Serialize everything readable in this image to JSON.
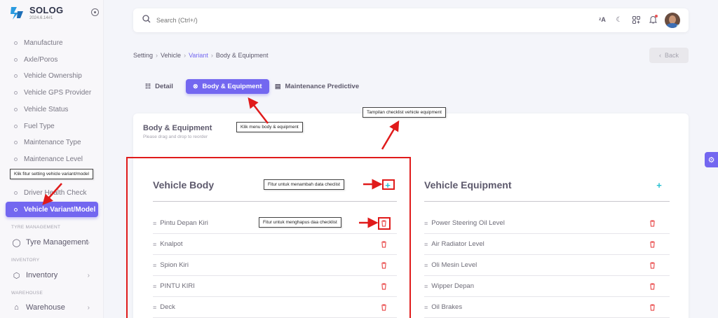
{
  "brand": {
    "name": "SOLOG",
    "version": "2024.6.14#1"
  },
  "sidebar": {
    "items": [
      {
        "label": "Manufacture"
      },
      {
        "label": "Axle/Poros"
      },
      {
        "label": "Vehicle Ownership"
      },
      {
        "label": "Vehicle GPS Provider"
      },
      {
        "label": "Vehicle Status"
      },
      {
        "label": "Fuel Type"
      },
      {
        "label": "Maintenance Type"
      },
      {
        "label": "Maintenance Level"
      },
      {
        "label": "Driver Health Check"
      },
      {
        "label": "Vehicle Variant/Model",
        "active": true
      }
    ],
    "sections": [
      {
        "label": "TYRE MANAGEMENT",
        "group": "Tyre Management"
      },
      {
        "label": "INVENTORY",
        "group": "Inventory"
      },
      {
        "label": "WAREHOUSE",
        "group": "Warehouse"
      }
    ]
  },
  "search": {
    "placeholder": "Search (Ctrl+/)"
  },
  "topbar": {
    "icons": [
      "translate-icon",
      "moon-icon",
      "apps-icon",
      "bell-icon",
      "avatar"
    ]
  },
  "breadcrumb": [
    "Setting",
    "Vehicle",
    "Variant",
    "Body & Equipment"
  ],
  "back_label": "Back",
  "tabs": [
    {
      "label": "Detail"
    },
    {
      "label": "Body & Equipment",
      "active": true
    },
    {
      "label": "Maintenance Predictive"
    }
  ],
  "card": {
    "title": "Body & Equipment",
    "subtitle": "Please drag and drop to reorder"
  },
  "vehicle_body": {
    "title": "Vehicle Body",
    "items": [
      "Pintu Depan Kiri",
      "Knalpot",
      "Spion Kiri",
      "PINTU KIRI",
      "Deck"
    ]
  },
  "vehicle_equipment": {
    "title": "Vehicle Equipment",
    "items": [
      "Power Steering Oil Level",
      "Air Radiator Level",
      "Oli Mesin Level",
      "Wipper Depan",
      "Oil Brakes"
    ]
  },
  "annotations": {
    "sidebar_hint": "Klik fitur setting vehicle variant/model",
    "tab_hint": "Klik menu body & equipment",
    "checklist_hint": "Tampilan checklist vehicle equipment",
    "add_hint": "Fitur untuk menambah data checlist",
    "delete_hint": "Fitur untuk menghapus daa checklist"
  },
  "colors": {
    "primary": "#7367f0",
    "annotation": "#e01b1b",
    "add": "#28c1d1",
    "delete": "#ea5455"
  }
}
